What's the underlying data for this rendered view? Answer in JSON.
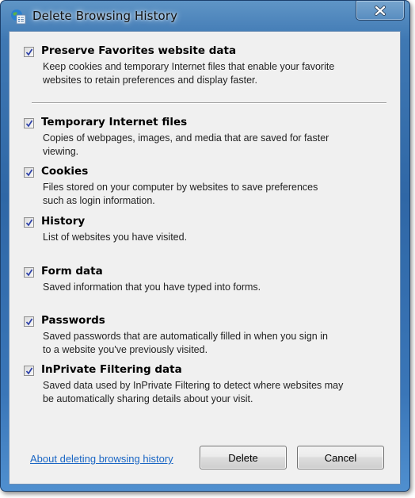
{
  "window": {
    "title": "Delete Browsing History",
    "icon": "ie-delete-history-icon",
    "close_icon": "close-icon"
  },
  "options": [
    {
      "label": "Preserve Favorites website data",
      "checked": true,
      "description": [
        "Keep cookies and temporary Internet files that enable your favorite",
        "websites to retain preferences and display faster."
      ]
    },
    {
      "label": "Temporary Internet files",
      "checked": true,
      "description": [
        "Copies of webpages, images, and media that are saved for faster",
        "viewing."
      ]
    },
    {
      "label": "Cookies",
      "checked": true,
      "description": [
        "Files stored on your computer by websites to save preferences",
        "such as login information."
      ]
    },
    {
      "label": "History",
      "checked": true,
      "description": [
        "List of websites you have visited."
      ]
    },
    {
      "label": "Form data",
      "checked": true,
      "description": [
        "Saved information that you have typed into forms."
      ]
    },
    {
      "label": "Passwords",
      "checked": true,
      "description": [
        "Saved passwords that are automatically filled in when you sign in",
        "to a website you've previously visited."
      ]
    },
    {
      "label": "InPrivate Filtering data",
      "checked": true,
      "description": [
        "Saved data used by InPrivate Filtering to detect where websites may",
        "be automatically sharing details about your visit."
      ]
    }
  ],
  "footer": {
    "help_link": "About deleting browsing history",
    "delete_label": "Delete",
    "cancel_label": "Cancel"
  },
  "colors": {
    "link": "#1a66c4",
    "frame": "#3a76b8",
    "client_bg": "#f0f0f0"
  }
}
